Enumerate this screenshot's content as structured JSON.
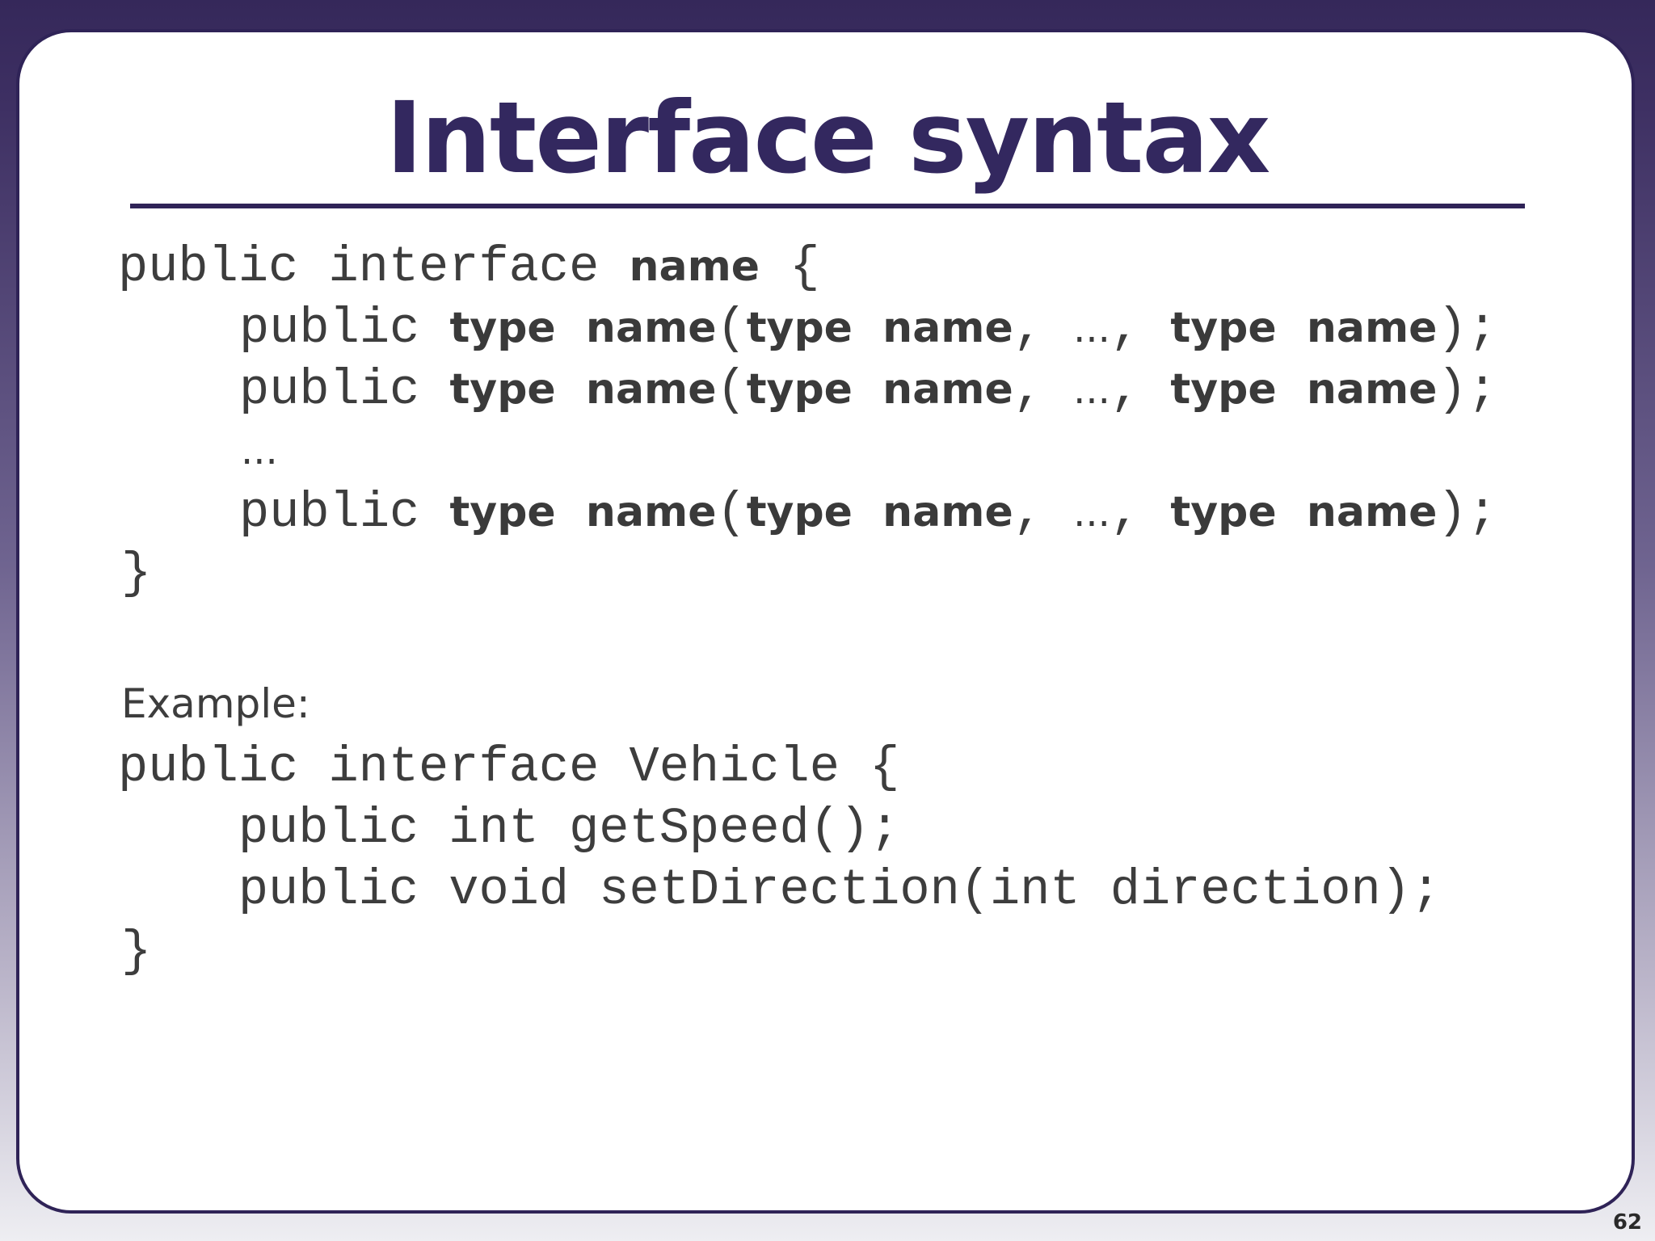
{
  "slide": {
    "title": "Interface syntax",
    "page_number": "62"
  },
  "syntax": {
    "line1": {
      "keywords": "public interface ",
      "name": "name",
      "brace": " {"
    },
    "method_public": "public ",
    "method_type": "type",
    "method_name": "name",
    "open_paren": "(",
    "param_sep": ", ",
    "ellipsis": "...",
    "close_paren": ");",
    "space": " ",
    "ellipsis_line": "...",
    "closing_brace": "}"
  },
  "example": {
    "label": "Example:",
    "lines": [
      "public interface Vehicle {",
      "    public int getSpeed();",
      "    public void setDirection(int direction);",
      "}"
    ]
  }
}
